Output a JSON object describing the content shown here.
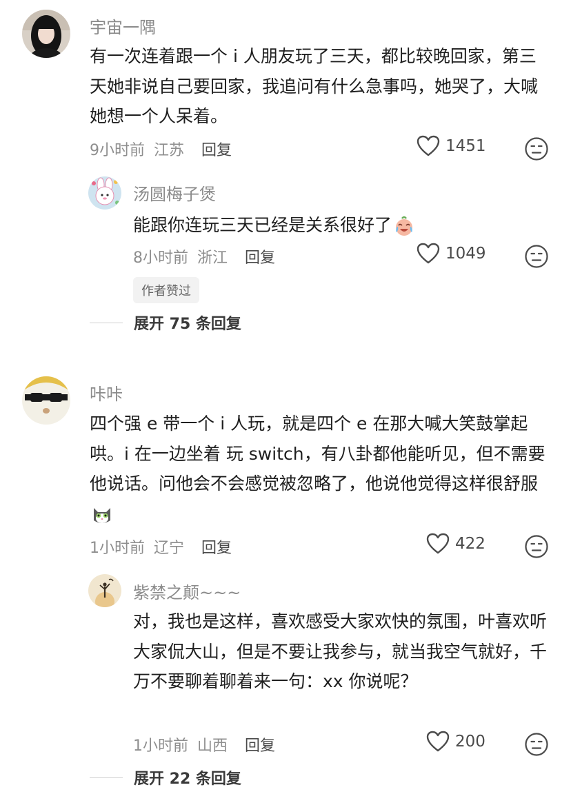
{
  "comments": [
    {
      "username": "宇宙一隅",
      "text": "有一次连着跟一个 i 人朋友玩了三天，都比较晚回家，第三天她非说自己要回家，我追问有什么急事吗，她哭了，大喊她想一个人呆着。",
      "time": "9小时前",
      "location": "江苏",
      "reply_label": "回复",
      "likes": "1451",
      "replies": [
        {
          "username": "汤圆梅子煲",
          "text": "能跟你连玩三天已经是关系很好了",
          "emoji": "crying-laughing-emoji",
          "time": "8小时前",
          "location": "浙江",
          "reply_label": "回复",
          "likes": "1049",
          "badge": "作者赞过"
        }
      ],
      "expand_label": "展开 75 条回复"
    },
    {
      "username": "咔咔",
      "text": "四个强 e 带一个 i 人玩，就是四个 e 在那大喊大笑鼓掌起哄。i 在一边坐着 玩 switch，有八卦都他能听见，但不需要他说话。问他会不会感觉被忽略了，他说他觉得这样很舒服",
      "emoji": "cat-emoji",
      "time": "1小时前",
      "location": "辽宁",
      "reply_label": "回复",
      "likes": "422",
      "replies": [
        {
          "username": "紫禁之颠~~~",
          "text": "对，我也是这样，喜欢感受大家欢快的氛围，叶喜欢听大家侃大山，但是不要让我参与，就当我空气就好，千万不要聊着聊着来一句：xx 你说呢？",
          "time": "1小时前",
          "location": "山西",
          "reply_label": "回复",
          "likes": "200"
        }
      ],
      "expand_label": "展开 22 条回复"
    }
  ],
  "icons": {
    "like": "heart-outline-icon",
    "dislike": "neutral-face-icon"
  },
  "colors": {
    "username": "#8b8b8b",
    "text": "#1f1f1f",
    "meta": "#8e8e8e",
    "badge_bg": "#f2f2f2"
  }
}
